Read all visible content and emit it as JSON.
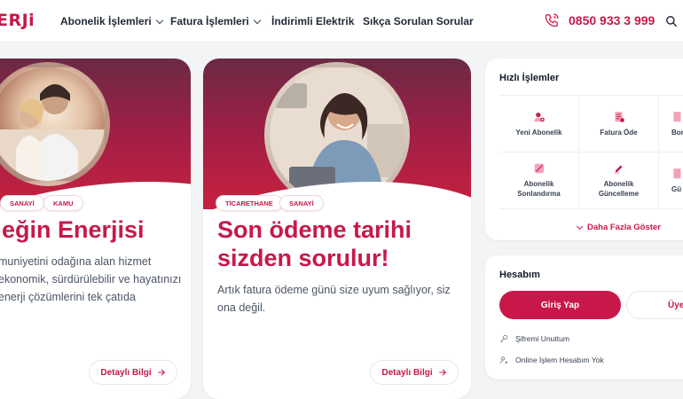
{
  "header": {
    "logo": "ERJi",
    "nav": [
      {
        "label": "Abonelik İşlemleri",
        "dropdown": true
      },
      {
        "label": "Fatura İşlemleri",
        "dropdown": true
      },
      {
        "label": "İndirimli Elektrik",
        "dropdown": false
      },
      {
        "label": "Sıkça Sorulan Sorular",
        "dropdown": false
      }
    ],
    "phone": "0850 933 3 999"
  },
  "cards": [
    {
      "tags": [
        "SANAYİ",
        "KAMU"
      ],
      "title": "eğin Enerjisi",
      "desc": [
        "muniyetini odağına alan hizmet",
        "ekonomik, sürdürülebilir ve hayatınızı",
        "enerji çözümlerini tek çatıda"
      ],
      "button": "Detaylı Bilgi"
    },
    {
      "tags": [
        "TİCARETHANE",
        "SANAYİ"
      ],
      "title": [
        "Son ödeme tarihi",
        "sizden sorulur!"
      ],
      "desc": [
        "Artık fatura ödeme günü size uyum sağlıyor, siz",
        "ona değil."
      ],
      "button": "Detaylı Bilgi"
    }
  ],
  "quick": {
    "title": "Hızlı İşlemler",
    "items": [
      {
        "label": "Yeni Abonelik",
        "icon": "user-add-icon"
      },
      {
        "label": "Fatura Öde",
        "icon": "invoice-icon"
      },
      {
        "label": "Bor",
        "icon": "document-icon"
      },
      {
        "label": "Abonelik Sonlandırma",
        "icon": "cancel-subscription-icon"
      },
      {
        "label": "Abonelik Güncelleme",
        "icon": "edit-icon"
      },
      {
        "label": "Gü",
        "icon": "document-icon"
      }
    ],
    "more": "Daha Fazla Göster"
  },
  "account": {
    "title": "Hesabım",
    "login": "Giriş Yap",
    "register": "Üye",
    "links": [
      "Şifremi Unuttum",
      "Online İşlem Hesabım Yok"
    ]
  },
  "colors": {
    "brand": "#c8184a",
    "background": "#f3f4f6"
  }
}
